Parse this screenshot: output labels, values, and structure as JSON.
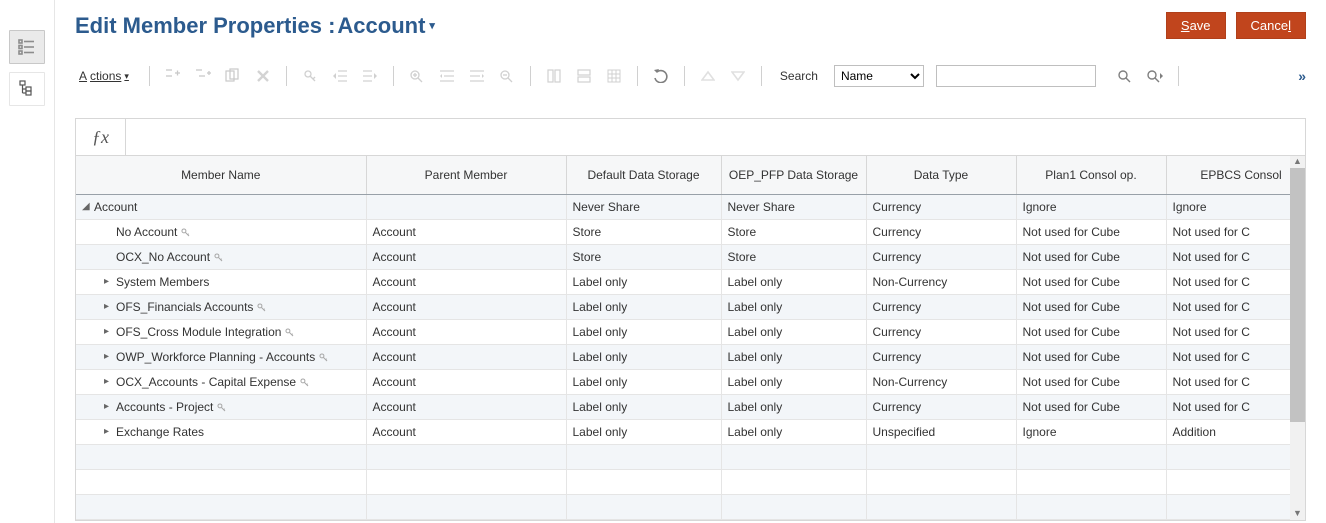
{
  "header": {
    "title_prefix": "Edit Member Properties :",
    "title_dimension": "Account",
    "save_label": "Save",
    "cancel_label": "Cancel"
  },
  "toolbar": {
    "actions_label": "Actions",
    "search_label": "Search",
    "search_field_options": [
      "Name"
    ],
    "search_field_selected": "Name",
    "search_value": ""
  },
  "table": {
    "columns": [
      "Member Name",
      "Parent Member",
      "Default Data Storage",
      "OEP_PFP Data Storage",
      "Data Type",
      "Plan1 Consol op.",
      "EPBCS Consol"
    ],
    "rows": [
      {
        "indent": 0,
        "toggle": "open",
        "name": "Account",
        "key": false,
        "parent": "",
        "storage": "Never Share",
        "storage2": "Never Share",
        "dtype": "Currency",
        "plan1": "Ignore",
        "epbcs": "Ignore"
      },
      {
        "indent": 1,
        "toggle": "leaf",
        "name": "No Account",
        "key": true,
        "parent": "Account",
        "storage": "Store",
        "storage2": "Store",
        "dtype": "Currency",
        "plan1": "Not used for Cube",
        "epbcs": "Not used for C"
      },
      {
        "indent": 1,
        "toggle": "leaf",
        "name": "OCX_No Account",
        "key": true,
        "parent": "Account",
        "storage": "Store",
        "storage2": "Store",
        "dtype": "Currency",
        "plan1": "Not used for Cube",
        "epbcs": "Not used for C"
      },
      {
        "indent": 1,
        "toggle": "close",
        "name": "System Members",
        "key": false,
        "parent": "Account",
        "storage": "Label only",
        "storage2": "Label only",
        "dtype": "Non-Currency",
        "plan1": "Not used for Cube",
        "epbcs": "Not used for C"
      },
      {
        "indent": 1,
        "toggle": "close",
        "name": "OFS_Financials Accounts",
        "key": true,
        "parent": "Account",
        "storage": "Label only",
        "storage2": "Label only",
        "dtype": "Currency",
        "plan1": "Not used for Cube",
        "epbcs": "Not used for C"
      },
      {
        "indent": 1,
        "toggle": "close",
        "name": "OFS_Cross Module Integration",
        "key": true,
        "parent": "Account",
        "storage": "Label only",
        "storage2": "Label only",
        "dtype": "Currency",
        "plan1": "Not used for Cube",
        "epbcs": "Not used for C"
      },
      {
        "indent": 1,
        "toggle": "close",
        "name": "OWP_Workforce Planning - Accounts",
        "key": true,
        "parent": "Account",
        "storage": "Label only",
        "storage2": "Label only",
        "dtype": "Currency",
        "plan1": "Not used for Cube",
        "epbcs": "Not used for C"
      },
      {
        "indent": 1,
        "toggle": "close",
        "name": "OCX_Accounts - Capital Expense",
        "key": true,
        "parent": "Account",
        "storage": "Label only",
        "storage2": "Label only",
        "dtype": "Non-Currency",
        "plan1": "Not used for Cube",
        "epbcs": "Not used for C"
      },
      {
        "indent": 1,
        "toggle": "close",
        "name": "Accounts - Project",
        "key": true,
        "parent": "Account",
        "storage": "Label only",
        "storage2": "Label only",
        "dtype": "Currency",
        "plan1": "Not used for Cube",
        "epbcs": "Not used for C"
      },
      {
        "indent": 1,
        "toggle": "close",
        "name": "Exchange Rates",
        "key": false,
        "parent": "Account",
        "storage": "Label only",
        "storage2": "Label only",
        "dtype": "Unspecified",
        "plan1": "Ignore",
        "epbcs": "Addition"
      }
    ]
  }
}
